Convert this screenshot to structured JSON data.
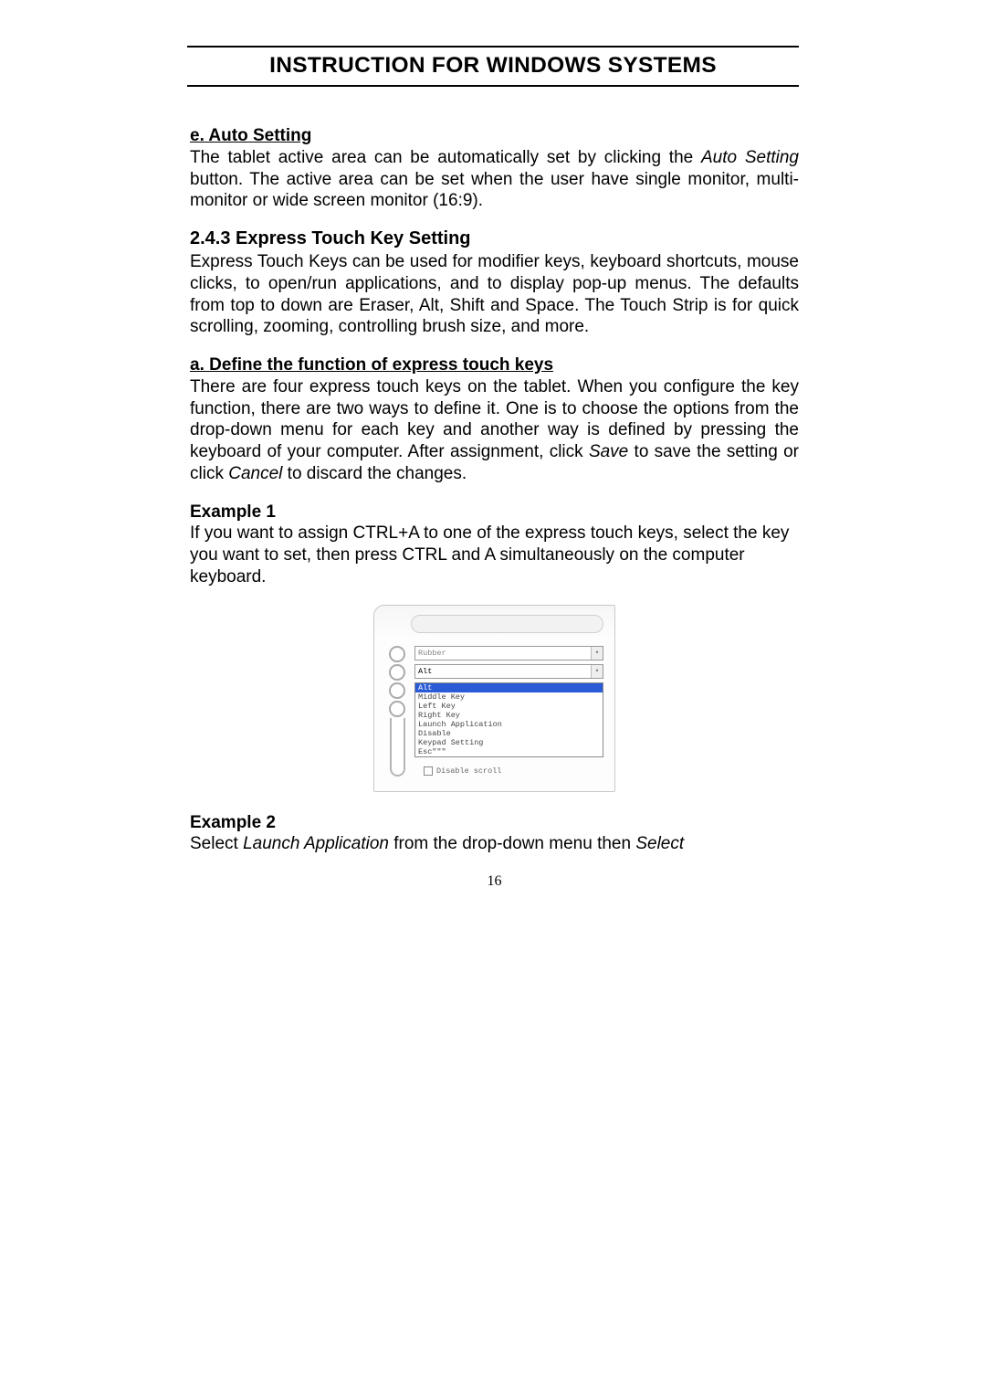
{
  "header": {
    "title": "INSTRUCTION FOR WINDOWS SYSTEMS"
  },
  "section_e": {
    "head": "e. Auto Setting",
    "p_part1": "The tablet active area can be automatically set by clicking the ",
    "p_italic": "Auto Setting",
    "p_part2": " button. The active area can be set when the user have single monitor, multi-monitor or wide screen monitor (16:9)."
  },
  "section_243": {
    "head": "2.4.3 Express Touch Key Setting",
    "p": "Express Touch Keys can be used for modifier keys, keyboard shortcuts, mouse clicks, to open/run applications, and to display pop-up menus. The defaults from top to down are Eraser, Alt, Shift and Space. The Touch Strip is for quick scrolling, zooming, controlling brush size, and more."
  },
  "section_a": {
    "head": "a. Define the function of express touch keys",
    "p_part1": "There are four express touch keys on the tablet. When you configure the key function, there are two ways to define it. One is to choose the options from the drop-down menu for each key and another way is defined by pressing the keyboard of your computer. After assignment, click ",
    "p_italic1": "Save",
    "p_mid": " to save the setting or click ",
    "p_italic2": "Cancel",
    "p_part2": " to discard the changes."
  },
  "example1": {
    "head": "Example 1",
    "p": "If you want to assign CTRL+A to one of the express touch keys, select the key you want to set, then press CTRL and A simultaneously on the computer keyboard."
  },
  "figure": {
    "combo1": "Rubber",
    "combo2": "Alt",
    "opts": [
      "Alt",
      "Middle Key",
      "Left Key",
      "Right Key",
      "Launch Application",
      "Disable",
      "Keypad Setting",
      "Esc\"\"\""
    ],
    "checkbox": "Disable scroll"
  },
  "example2": {
    "head": "Example 2",
    "p_part1": "Select ",
    "p_italic1": "Launch Application",
    "p_mid": " from the drop-down menu then ",
    "p_italic2": "Select"
  },
  "page_number": "16"
}
